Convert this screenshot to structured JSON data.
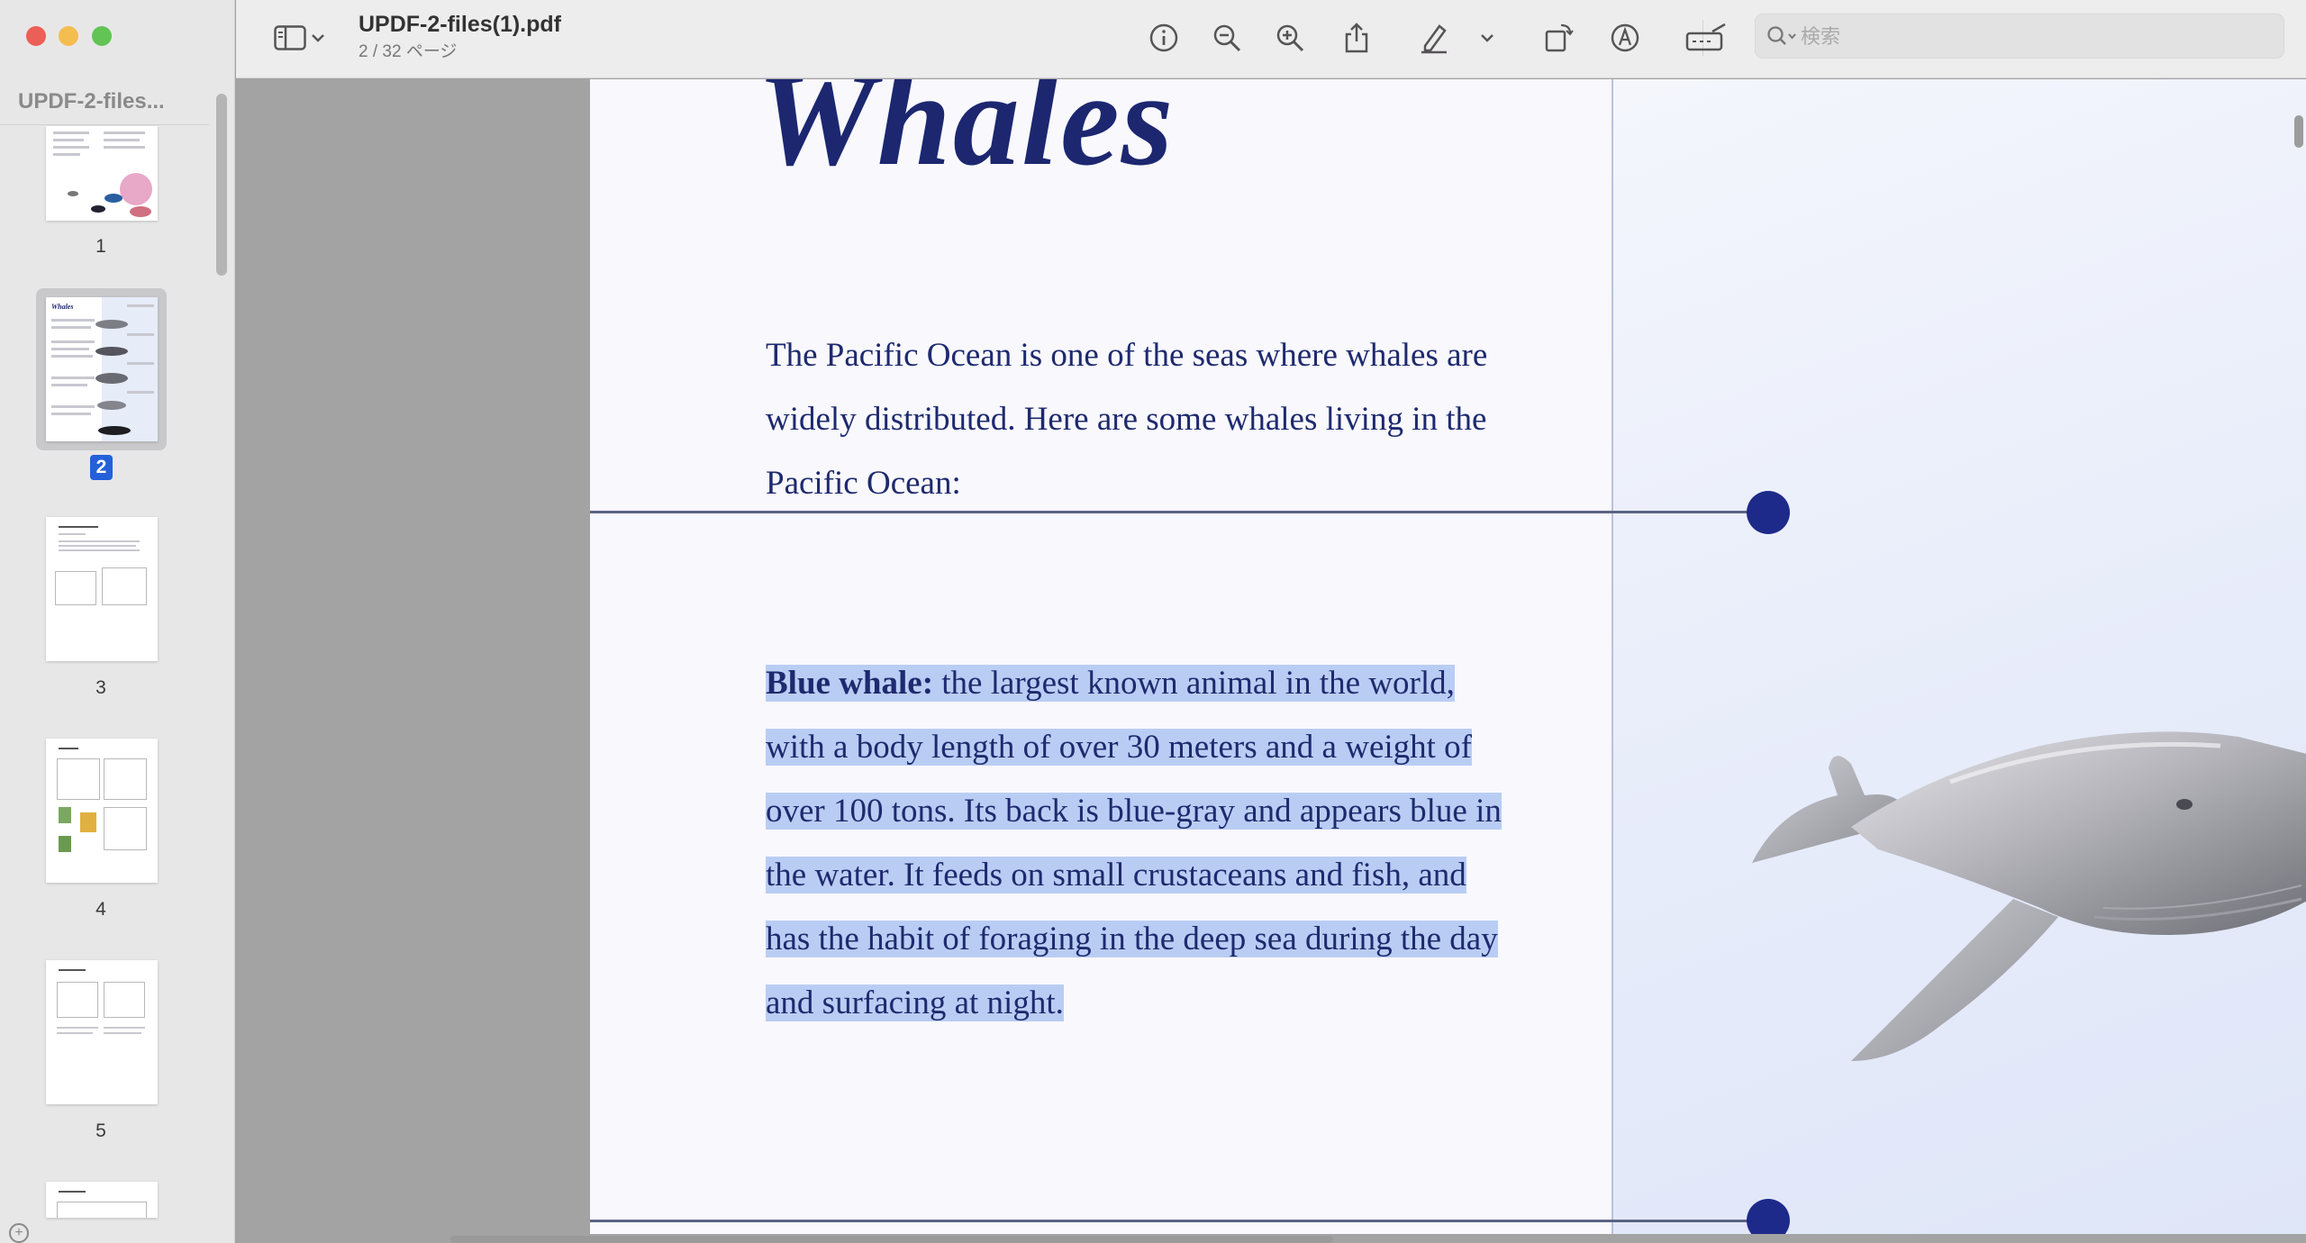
{
  "window": {
    "sidebar_title": "UPDF-2-files...",
    "doc_title": "UPDF-2-files(1).pdf",
    "doc_page_info": "2 / 32 ページ"
  },
  "toolbar": {
    "search_placeholder": "検索",
    "icons": [
      "sidebar-toggle-icon",
      "chevron-down-icon",
      "info-icon",
      "zoom-out-icon",
      "zoom-in-icon",
      "share-icon",
      "highlighter-icon",
      "chevron-down-icon",
      "rotate-icon",
      "markup-icon",
      "signature-icon",
      "search-icon"
    ]
  },
  "thumbnails": [
    {
      "label": "1"
    },
    {
      "label": "2",
      "selected": true
    },
    {
      "label": "3"
    },
    {
      "label": "4"
    },
    {
      "label": "5"
    }
  ],
  "page": {
    "title": "Whales",
    "intro": "The Pacific Ocean is one of the seas where whales are widely distributed. Here are some whales living in the Pacific Ocean:",
    "blue_whale_label": "Blue whale:",
    "blue_whale_text": " the largest known animal in the world, with a body length of over 30 meters and a weight of over 100 tons. Its back is blue-gray and appears blue in the water. It feeds on small crustaceans and fish, and has the habit of foraging in the deep sea during the day and surfacing at night.",
    "selection_color": "#b9cdf4",
    "text_color": "#1e2a6e",
    "accent_dot_color": "#1e2a8a"
  }
}
